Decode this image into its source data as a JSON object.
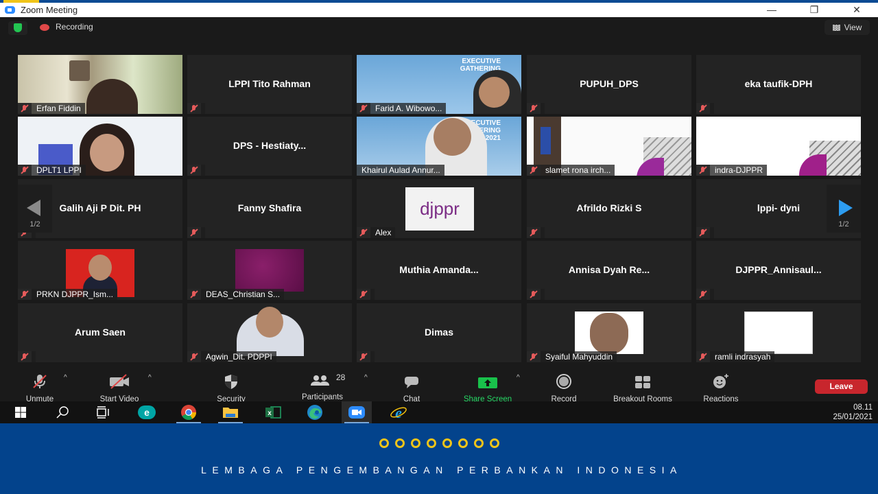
{
  "window": {
    "title": "Zoom Meeting",
    "buttons": [
      "—",
      "❐",
      "✕"
    ]
  },
  "meeting_bar": {
    "security_status": "encrypted",
    "recording_label": "Recording",
    "view_label": "View"
  },
  "gallery": {
    "page_indicator_left": "1/2",
    "page_indicator_right": "1/2",
    "tiles": [
      {
        "name": "Erfan Fiddin",
        "video": true,
        "muted": true
      },
      {
        "name": "LPPI Tito Rahman",
        "video": false,
        "muted": true
      },
      {
        "name": "Farid A. Wibowo...",
        "video": true,
        "muted": true
      },
      {
        "name": "PUPUH_DPS",
        "video": false,
        "muted": true
      },
      {
        "name": "eka taufik-DPH",
        "video": false,
        "muted": true
      },
      {
        "name": "DPLT1 LPPI",
        "video": true,
        "muted": true
      },
      {
        "name": "DPS  -  Hestiaty...",
        "video": false,
        "muted": true
      },
      {
        "name": "Khairul Aulad Annur...",
        "video": true,
        "muted": false,
        "active_speaker": true
      },
      {
        "name": "slamet rona irch...",
        "video": true,
        "muted": true
      },
      {
        "name": "indra-DJPPR",
        "video": true,
        "muted": true
      },
      {
        "name": "Galih Aji P Dit. PH",
        "video": false,
        "muted": true
      },
      {
        "name": "Fanny Shafira",
        "video": false,
        "muted": true
      },
      {
        "name": "Alex",
        "video": false,
        "muted": true,
        "profile_picture_text": "djppr"
      },
      {
        "name": "Afrildo Rizki S",
        "video": false,
        "muted": true
      },
      {
        "name": "lppi- dyni",
        "video": false,
        "muted": true
      },
      {
        "name": "PRKN DJPPR_Ism...",
        "video": false,
        "muted": true
      },
      {
        "name": "DEAS_Christian S...",
        "video": false,
        "muted": true
      },
      {
        "name": "Muthia  Amanda...",
        "video": false,
        "muted": true
      },
      {
        "name": "Annisa Dyah Re...",
        "video": false,
        "muted": true
      },
      {
        "name": "DJPPR_Annisaul...",
        "video": false,
        "muted": true
      },
      {
        "name": "Arum Saen",
        "video": false,
        "muted": true
      },
      {
        "name": "Agwin_Dit. PDPPI",
        "video": false,
        "muted": true
      },
      {
        "name": "Dimas",
        "video": false,
        "muted": true
      },
      {
        "name": "Syaiful Mahyuddin",
        "video": false,
        "muted": true
      },
      {
        "name": "ramli indrasyah",
        "video": false,
        "muted": true
      }
    ],
    "slide_text": {
      "line1": "EXECUTIVE",
      "line2": "GATHERING",
      "year": "2021"
    }
  },
  "toolbar": {
    "unmute": "Unmute",
    "start_video": "Start Video",
    "security": "Security",
    "participants": "Participants",
    "participant_count": "28",
    "chat": "Chat",
    "share_screen": "Share Screen",
    "record": "Record",
    "breakout_rooms": "Breakout Rooms",
    "reactions": "Reactions",
    "leave": "Leave"
  },
  "taskbar": {
    "apps": [
      "start",
      "search",
      "task-view",
      "eset",
      "chrome",
      "file-explorer",
      "excel",
      "edge",
      "zoom",
      "internet-explorer"
    ],
    "time": "08.11",
    "date": "25/01/2021"
  },
  "footer": {
    "ring_count": 8,
    "organization": "LEMBAGA PENGEMBANGAN PERBANKAN INDONESIA",
    "colors": {
      "background": "#03438c",
      "accent": "#f0c419"
    }
  }
}
